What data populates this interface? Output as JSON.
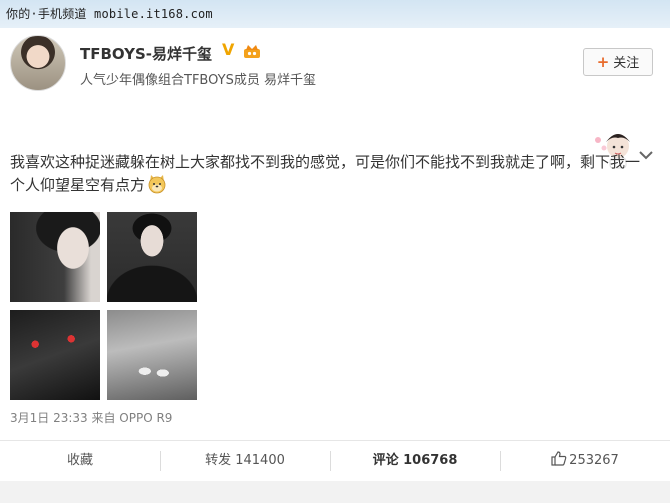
{
  "watermark": {
    "text": "你的·手机频道 mobile.it168.com"
  },
  "profile": {
    "username": "TFBOYS-易烊千玺",
    "verified_badge": "V",
    "bio": "人气少年偶像组合TFBOYS成员 易烊千玺",
    "follow_label": "关注",
    "avatar_icon": "avatar",
    "crown_icon": "crown-icon"
  },
  "post": {
    "text": "我喜欢这种捉迷藏躲在树上大家都找不到我的感觉，可是你们不能找不到我就走了啊，剩下我一个人仰望星空有点方",
    "emoji_icon": "doge-emoji-icon",
    "meta": "3月1日 23:33 来自 OPPO R9"
  },
  "actions": {
    "favorite": "收藏",
    "repost": "转发 141400",
    "comment": "评论 106768",
    "like_count": "253267"
  },
  "colors": {
    "accent_orange": "#e86b2c",
    "badge_gold": "#f0a500",
    "page_bg": "#e3eef7"
  }
}
